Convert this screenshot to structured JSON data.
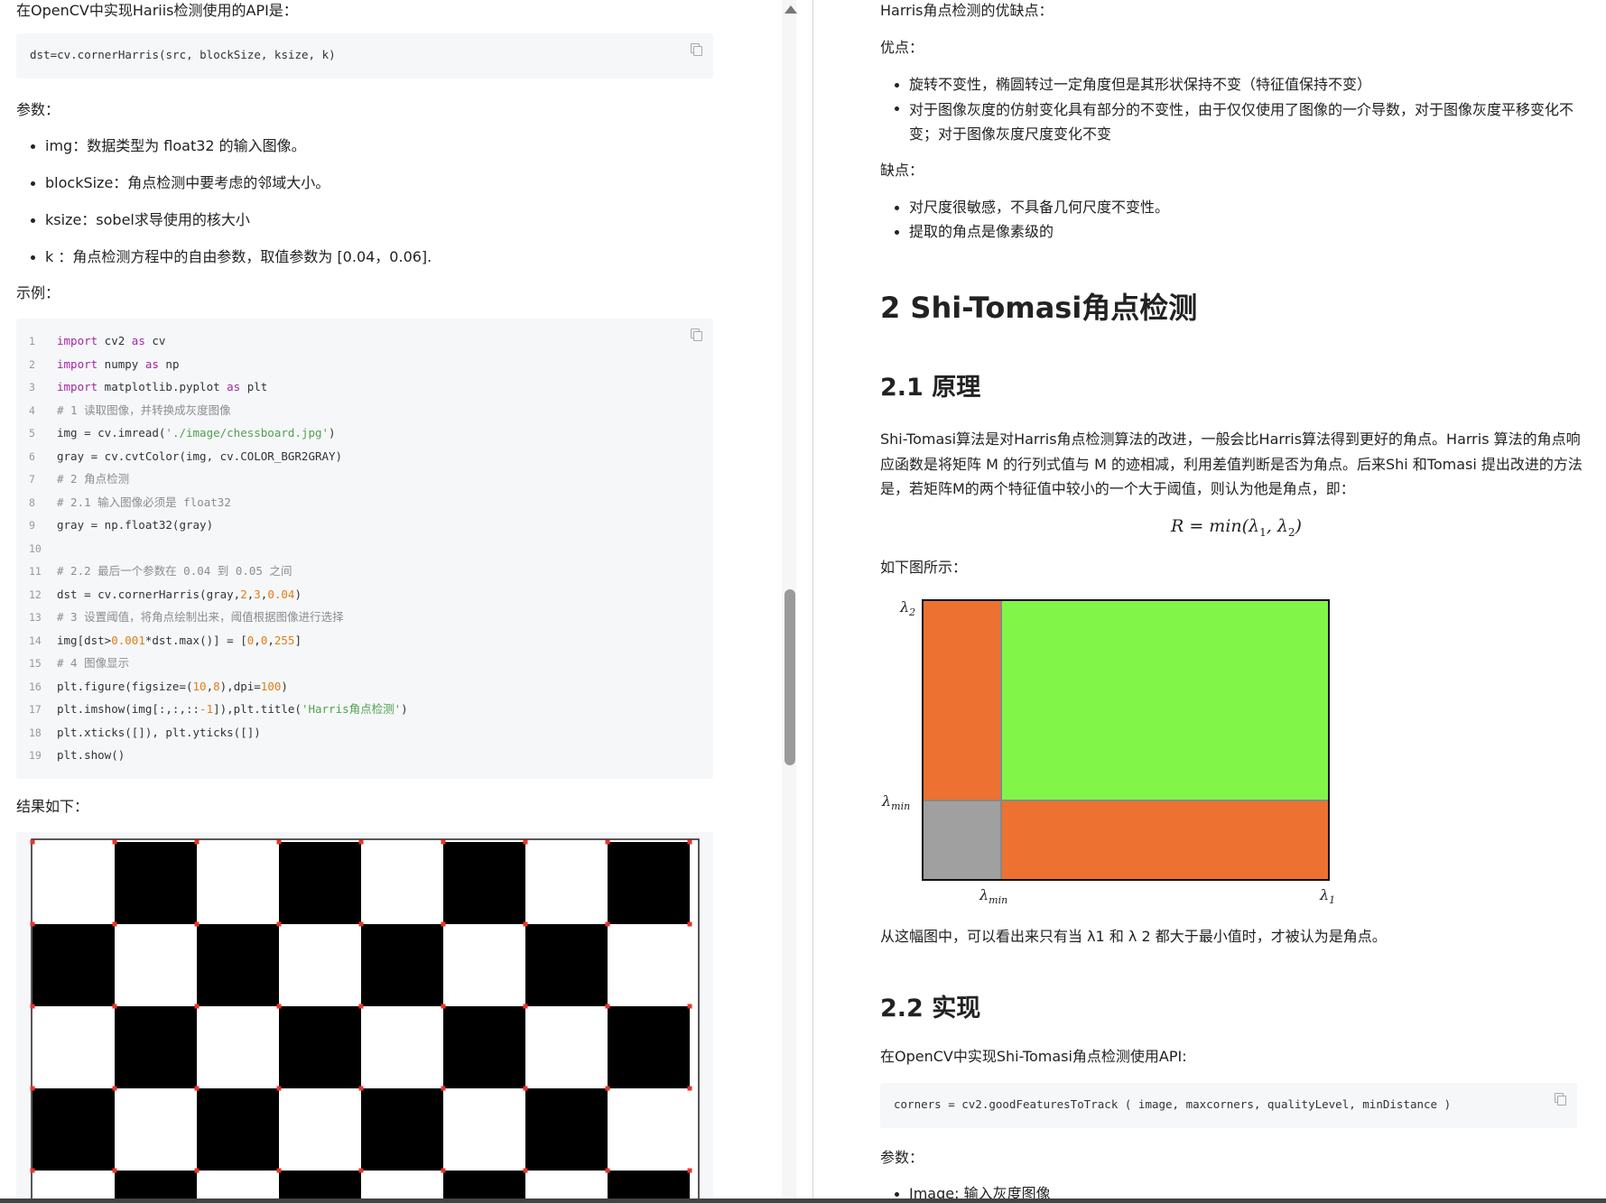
{
  "left": {
    "intro": "在OpenCV中实现Hariis检测使用的API是：",
    "api_code": "dst=cv.cornerHarris(src, blockSize, ksize, k)",
    "params_label": "参数：",
    "params": [
      "img：数据类型为 float32 的输入图像。",
      "blockSize：角点检测中要考虑的邻域大小。",
      "ksize：sobel求导使用的核大小",
      "k ：角点检测方程中的自由参数，取值参数为 [0.04，0.06]."
    ],
    "example_label": "示例：",
    "code_lines": [
      "1",
      "2",
      "3",
      "4",
      "5",
      "6",
      "7",
      "8",
      "9",
      "10",
      "11",
      "12",
      "13",
      "14",
      "15",
      "16",
      "17",
      "18",
      "19"
    ],
    "code_text": {
      "l1a": "import",
      "l1b": " cv2 ",
      "l1c": "as",
      "l1d": " cv",
      "l2a": "import",
      "l2b": " numpy ",
      "l2c": "as",
      "l2d": " np",
      "l3a": "import",
      "l3b": " matplotlib.pyplot ",
      "l3c": "as",
      "l3d": " plt",
      "l4": "# 1 读取图像，并转换成灰度图像",
      "l5a": "img = cv.imread(",
      "l5b": "'./image/chessboard.jpg'",
      "l5c": ")",
      "l6": "gray = cv.cvtColor(img, cv.COLOR_BGR2GRAY)",
      "l7": "# 2 角点检测",
      "l8": "# 2.1 输入图像必须是 float32",
      "l9": "gray = np.float32(gray)",
      "l10": "",
      "l11": "# 2.2 最后一个参数在 0.04 到 0.05 之间",
      "l12a": "dst = cv.cornerHarris(gray,",
      "l12b": "2",
      "l12c": ",",
      "l12d": "3",
      "l12e": ",",
      "l12f": "0.04",
      "l12g": ")",
      "l13": "# 3 设置阈值，将角点绘制出来，阈值根据图像进行选择",
      "l14a": "img[dst>",
      "l14b": "0.001",
      "l14c": "*dst.max()] = [",
      "l14d": "0",
      "l14e": ",",
      "l14f": "0",
      "l14g": ",",
      "l14h": "255",
      "l14i": "]",
      "l15": "# 4 图像显示",
      "l16a": "plt.figure(figsize=(",
      "l16b": "10",
      "l16c": ",",
      "l16d": "8",
      "l16e": "),dpi=",
      "l16f": "100",
      "l16g": ")",
      "l17a": "plt.imshow(img[:,:,::",
      "l17b": "-1",
      "l17c": "]),plt.title(",
      "l17d": "'Harris角点检测'",
      "l17e": ")",
      "l18": "plt.xticks([]), plt.yticks([])",
      "l19": "plt.show()"
    },
    "result_label": "结果如下："
  },
  "right": {
    "pros_cons_title": "Harris角点检测的优缺点：",
    "pros_label": "优点：",
    "pros": [
      "旋转不变性，椭圆转过一定角度但是其形状保持不变（特征值保持不变）",
      "对于图像灰度的仿射变化具有部分的不变性，由于仅仅使用了图像的一介导数，对于图像灰度平移变化不变；对于图像灰度尺度变化不变"
    ],
    "cons_label": "缺点：",
    "cons": [
      "对尺度很敏感，不具备几何尺度不变性。",
      "提取的角点是像素级的"
    ],
    "h2": "2 Shi-Tomasi角点检测",
    "h3_principle": "2.1 原理",
    "principle_text": "Shi-Tomasi算法是对Harris角点检测算法的改进，一般会比Harris算法得到更好的角点。Harris 算法的角点响应函数是将矩阵 M 的行列式值与 M 的迹相减，利用差值判断是否为角点。后来Shi 和Tomasi 提出改进的方法是，若矩阵M的两个特征值中较小的一个大于阈值，则认为他是角点，即：",
    "formula": {
      "lhs": "R = min(λ",
      "sub1": "1",
      "mid": ", λ",
      "sub2": "2",
      "end": ")"
    },
    "figure_caption": "如下图所示：",
    "diagram": {
      "label_l2": "λ",
      "label_l2_sub": "2",
      "label_lmin_y": "λ",
      "label_lmin_y_sub": "min",
      "label_lmin_x": "λ",
      "label_lmin_x_sub": "min",
      "label_l1": "λ",
      "label_l1_sub": "1",
      "color_corner": "#82f549",
      "color_edge": "#ed7130",
      "color_flat": "#a0a0a0"
    },
    "after_figure": "从这幅图中，可以看出来只有当 λ1 和 λ 2 都大于最小值时，才被认为是角点。",
    "h3_impl": "2.2 实现",
    "impl_intro": "在OpenCV中实现Shi-Tomasi角点检测使用API:",
    "impl_code": "corners = cv2.goodFeaturesToTrack ( image, maxcorners, qualityLevel, minDistance )",
    "impl_params_label": "参数：",
    "impl_params": [
      "Image: 输入灰度图像"
    ]
  }
}
